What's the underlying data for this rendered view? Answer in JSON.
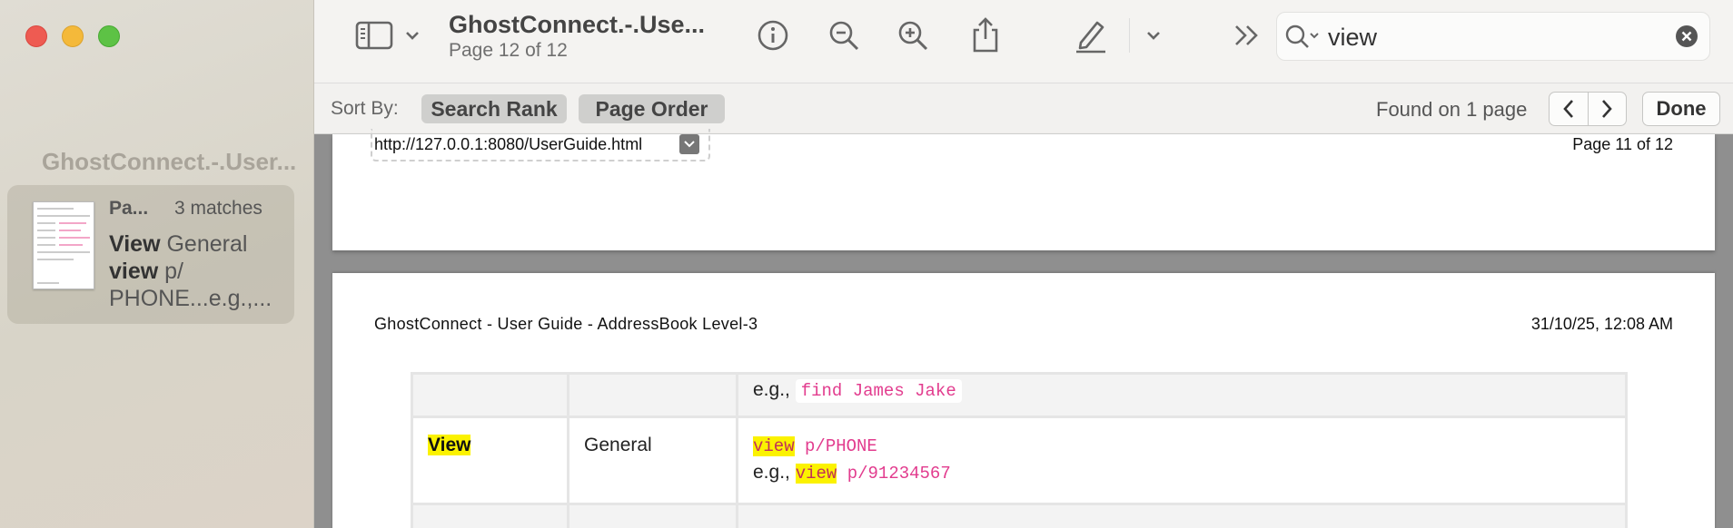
{
  "sidebar": {
    "doc_title": "GhostConnect.-.User...",
    "result": {
      "page_label": "Pa...",
      "match_count": "3 matches",
      "snippet_b1": "View",
      "snippet_t1": " General ",
      "snippet_b2": "view",
      "snippet_t2": " p/ PHONE...e.g.,..."
    }
  },
  "toolbar": {
    "title": "GhostConnect.-.Use...",
    "subtitle": "Page 12 of 12",
    "search_value": "view",
    "icons": [
      "sidebar-icon",
      "chevron-down-icon",
      "info-icon",
      "zoom-out-icon",
      "zoom-in-icon",
      "share-icon",
      "markup-pen-icon",
      "chevron-down-icon",
      "more-chevrons-icon",
      "search-icon",
      "clear-icon"
    ]
  },
  "sortbar": {
    "label": "Sort By:",
    "search_rank": "Search Rank",
    "page_order": "Page Order",
    "found": "Found on 1 page",
    "done": "Done"
  },
  "document": {
    "page1": {
      "url": "http://127.0.0.1:8080/UserGuide.html",
      "page_num": "Page 11 of 12"
    },
    "page2": {
      "header_left": "GhostConnect - User Guide - AddressBook Level-3",
      "header_right": "31/10/25, 12:08 AM",
      "table": {
        "row_top": {
          "eg": "e.g., ",
          "code": "find James Jake"
        },
        "row_view": {
          "action": "View",
          "category": "General",
          "code1_hl": "view",
          "code1_rest": " p/PHONE",
          "eg": "e.g., ",
          "code2_hl": "view",
          "code2_rest": " p/91234567"
        }
      }
    }
  },
  "colors": {
    "highlight": "#fbf200",
    "code": "#e23c8e"
  }
}
